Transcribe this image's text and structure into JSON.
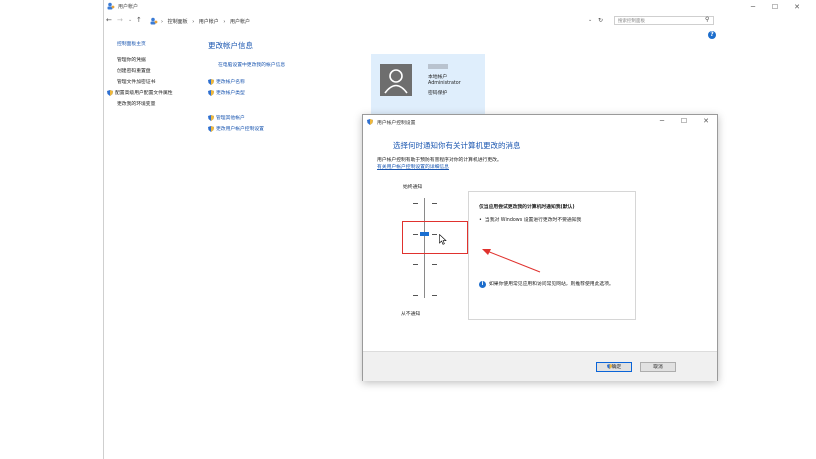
{
  "window": {
    "title": "用户帐户",
    "minimize": "─",
    "maximize": "☐",
    "close": "✕"
  },
  "address_bar": {
    "back": "←",
    "forward": "→",
    "dropdown": "⌄",
    "up": "↑",
    "crumbs": [
      "控制面板",
      "用户帐户",
      "用户帐户"
    ],
    "sep": "›",
    "search_placeholder": "搜索控制面板",
    "refresh": "↻",
    "search_icon": "⚲"
  },
  "sidebar": {
    "home": "控制面板主页",
    "links": [
      "管理你的凭据",
      "创建密码重置盘",
      "管理文件加密证书",
      "配置高级用户配置文件属性",
      "更改我的环境变量"
    ]
  },
  "main": {
    "title": "更改帐户信息",
    "settings_link": "在电脑设置中更改我的帐户信息",
    "actions": [
      "更改帐户名称",
      "更改帐户类型"
    ],
    "other_actions": [
      "管理其他帐户",
      "更改用户帐户控制设置"
    ]
  },
  "account": {
    "name": "本地帐户",
    "type": "Administrator",
    "status": "密码保护"
  },
  "uac": {
    "title": "用户帐户控制设置",
    "heading": "选择何时通知你有关计算机更改的消息",
    "desc": "用户帐户控制有助于预防有害程序对你的计算机进行更改。",
    "more_link": "有关用户帐户控制设置的详细信息",
    "top_label": "始终通知",
    "bottom_label": "从不通知",
    "slider_level": 2,
    "slider_levels": 4,
    "panel_title": "仅当应用尝试更改我的计算机时通知我(默认)",
    "bullet": "当我对 Windows 设置进行更改时不要通知我",
    "note": "如果你使用常见应用和访问常见网站，则推荐使用此选项。",
    "ok": "确定",
    "cancel": "取消",
    "dlg_min": "─",
    "dlg_max": "☐",
    "dlg_close": "✕"
  },
  "colors": {
    "link_blue": "#1a56b0",
    "card_bg": "#dfeefc",
    "thumb": "#1a6fd1",
    "annotation_red": "#e0322e"
  }
}
